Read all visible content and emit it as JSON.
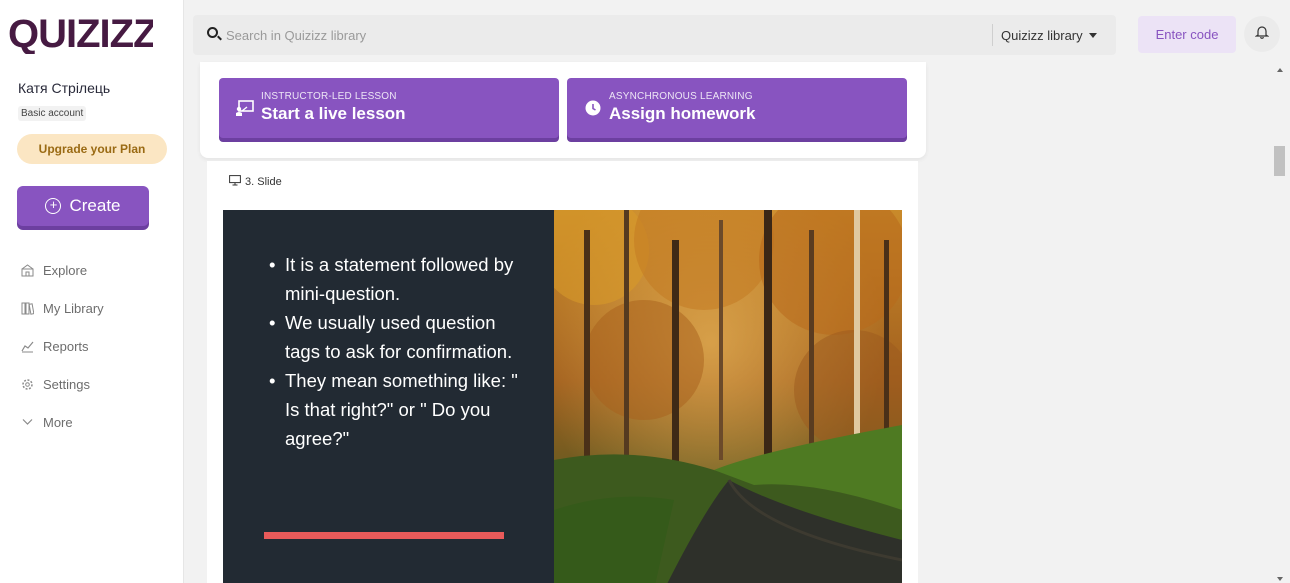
{
  "brand": {
    "logo_text": "QUIZIZZ",
    "accent": "#8854c0",
    "logo_color": "#461a42"
  },
  "sidebar": {
    "user_name": "Катя Стрілець",
    "plan_badge": "Basic account",
    "upgrade_label": "Upgrade your Plan",
    "create_label": "Create",
    "nav": [
      {
        "label": "Explore",
        "icon": "explore-icon"
      },
      {
        "label": "My Library",
        "icon": "library-icon"
      },
      {
        "label": "Reports",
        "icon": "reports-icon"
      },
      {
        "label": "Settings",
        "icon": "gear-icon"
      },
      {
        "label": "More",
        "icon": "chevron-down-icon"
      }
    ]
  },
  "topbar": {
    "search_placeholder": "Search in Quizizz library",
    "search_value": "",
    "library_select": "Quizizz library",
    "enter_code_label": "Enter code"
  },
  "actions": {
    "live": {
      "kicker": "INSTRUCTOR-LED LESSON",
      "label": "Start a live lesson"
    },
    "homework": {
      "kicker": "ASYNCHRONOUS LEARNING",
      "label": "Assign homework"
    }
  },
  "slide_card": {
    "label": "3. Slide",
    "bullets": [
      "It is a statement followed by mini-question.",
      "We usually used question tags to ask for confirmation.",
      "They mean something like: \" Is that right?\" or \" Do you agree?\""
    ],
    "bg_color": "#222a33",
    "bar_color": "#e95a5a"
  }
}
